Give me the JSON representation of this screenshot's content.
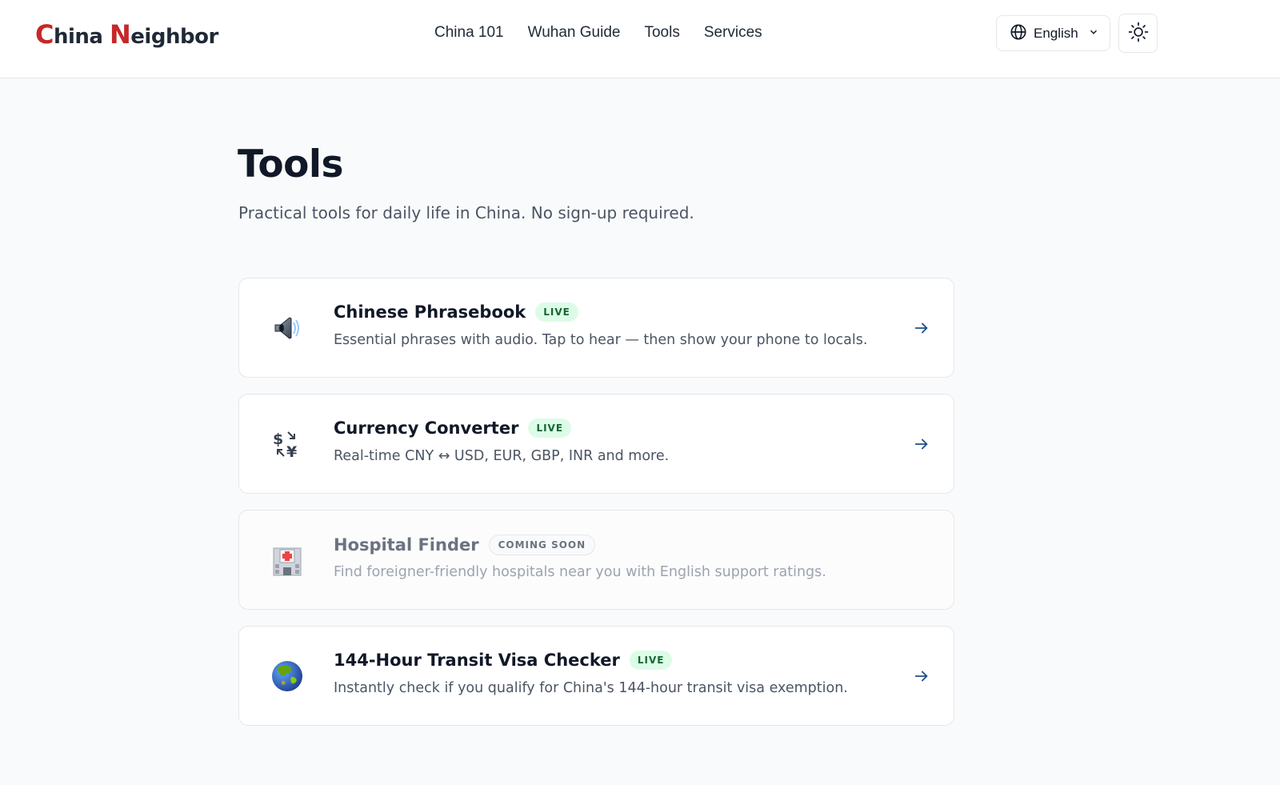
{
  "brand": {
    "first_initial": "C",
    "first_rest": "hina ",
    "second_initial": "N",
    "second_rest": "eighbor"
  },
  "nav": [
    {
      "label": "China 101"
    },
    {
      "label": "Wuhan Guide"
    },
    {
      "label": "Tools"
    },
    {
      "label": "Services"
    }
  ],
  "language": {
    "label": "English",
    "icon": "globe-icon",
    "dropdown_icon": "chevron-down-icon"
  },
  "theme_toggle": {
    "icon": "sun-icon"
  },
  "page": {
    "title": "Tools",
    "subtitle": "Practical tools for daily life in China. No sign-up required."
  },
  "tools": [
    {
      "title": "Chinese Phrasebook",
      "badge": "LIVE",
      "status": "live",
      "icon": "speaker-icon",
      "description": "Essential phrases with audio. Tap to hear — then show your phone to locals."
    },
    {
      "title": "Currency Converter",
      "badge": "LIVE",
      "status": "live",
      "icon": "currency-exchange-icon",
      "description": "Real-time CNY ↔ USD, EUR, GBP, INR and more."
    },
    {
      "title": "Hospital Finder",
      "badge": "COMING SOON",
      "status": "coming-soon",
      "icon": "hospital-icon",
      "description": "Find foreigner-friendly hospitals near you with English support ratings."
    },
    {
      "title": "144-Hour Transit Visa Checker",
      "badge": "LIVE",
      "status": "live",
      "icon": "globe-asia-icon",
      "description": "Instantly check if you qualify for China's 144-hour transit visa exemption."
    }
  ],
  "colors": {
    "brand_red": "#c62828",
    "live_badge_bg": "#dcfce7",
    "live_badge_text": "#166534",
    "arrow": "#1e4e8c"
  }
}
